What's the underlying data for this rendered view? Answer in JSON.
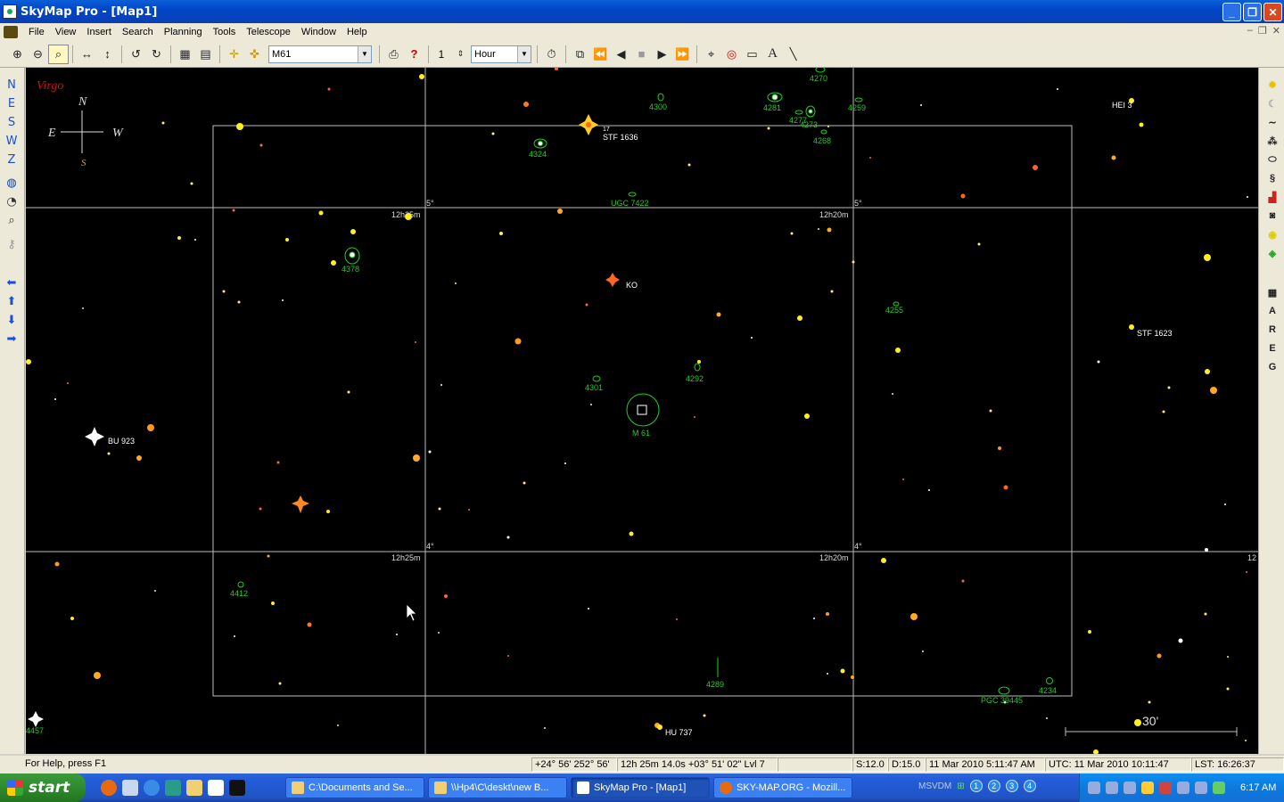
{
  "window": {
    "title": "SkyMap Pro - [Map1]"
  },
  "menu": [
    "File",
    "View",
    "Insert",
    "Search",
    "Planning",
    "Tools",
    "Telescope",
    "Window",
    "Help"
  ],
  "toolbar": {
    "object_field": "M61",
    "step_value": "1",
    "step_unit": "Hour",
    "icons": [
      "zoom-in-icon",
      "zoom-out-icon",
      "zoom-select-icon",
      "pan-horizontal-icon",
      "pan-vertical-icon",
      "rotate-left-icon",
      "rotate-right-icon",
      "grid-icon",
      "grid-alt-icon",
      "center-icon",
      "center-alt-icon",
      "print-icon",
      "help-pointer-icon",
      "stopwatch-icon",
      "link-icon",
      "rewind-icon",
      "step-back-icon",
      "stop-icon",
      "play-icon",
      "fast-forward-icon",
      "telescope-icon",
      "target-icon",
      "rectangle-icon",
      "text-icon",
      "line-icon"
    ]
  },
  "leftbar": {
    "directions": [
      "N",
      "E",
      "S",
      "W",
      "Z"
    ],
    "icons": [
      "globe-icon",
      "compass-icon",
      "magnifier-icon",
      "key-icon",
      "arrow-left-icon",
      "arrow-up-icon",
      "arrow-down-icon",
      "arrow-right-icon"
    ]
  },
  "rightbar": {
    "icons": [
      "sun-icon",
      "moon-icon",
      "comet-icon",
      "asteroid-icon",
      "galaxy-icon",
      "nebula-icon",
      "cluster-icon",
      "camera-icon",
      "bulb-icon",
      "colors-icon",
      "grid-table-icon"
    ],
    "letters": [
      "A",
      "R",
      "E",
      "G"
    ]
  },
  "map": {
    "constellation": "Virgo",
    "compass": {
      "n": "N",
      "e": "E",
      "w": "W",
      "s": "S"
    },
    "ra_labels": [
      "12h25m",
      "12h20m",
      "12h25m",
      "12h20m",
      "12"
    ],
    "dec_labels": [
      "5°",
      "5°",
      "4°",
      "4°"
    ],
    "objects": [
      {
        "label": "4270",
        "color": "#22cc22"
      },
      {
        "label": "4300",
        "color": "#22cc22"
      },
      {
        "label": "4281",
        "color": "#22cc22"
      },
      {
        "label": "4259",
        "color": "#22cc22"
      },
      {
        "label": "4277",
        "color": "#22cc22"
      },
      {
        "label": "4273",
        "color": "#22cc22"
      },
      {
        "label": "4268",
        "color": "#22cc22"
      },
      {
        "label": "4324",
        "color": "#22cc22"
      },
      {
        "label": "UGC 7422",
        "color": "#22cc22"
      },
      {
        "label": "4378",
        "color": "#22cc22"
      },
      {
        "label": "4255",
        "color": "#22cc22"
      },
      {
        "label": "4301",
        "color": "#22cc22"
      },
      {
        "label": "4292",
        "color": "#22cc22"
      },
      {
        "label": "M 61",
        "color": "#22cc22"
      },
      {
        "label": "4412",
        "color": "#22cc22"
      },
      {
        "label": "4289",
        "color": "#22cc22"
      },
      {
        "label": "PGC 39445",
        "color": "#22cc22"
      },
      {
        "label": "4234",
        "color": "#22cc22"
      },
      {
        "label": "4457",
        "color": "#22cc22"
      }
    ],
    "star_labels": [
      "STF 1636",
      "17",
      "HEI 3",
      "KO",
      "STF 1623",
      "BU 923",
      "HU 737"
    ],
    "scale_label": "30'"
  },
  "status": {
    "help": "For Help, press F1",
    "altaz": "+24° 56'  252° 56'",
    "radec": "12h 25m 14.0s  +03° 51' 02\"  Lvl 7",
    "s": "S:12.0",
    "d": "D:15.0",
    "local_time": "11 Mar 2010 5:11:47 AM",
    "utc": "UTC: 11 Mar 2010 10:11:47",
    "lst": "LST: 16:26:37"
  },
  "taskbar": {
    "start": "start",
    "tasks": [
      "C:\\Documents and Se...",
      "\\\\Hp4\\C\\deskt\\new B...",
      "SkyMap Pro - [Map1]",
      "SKY-MAP.ORG - Mozill..."
    ],
    "lang": "MSVDM",
    "desktops": [
      "1",
      "2",
      "3",
      "4"
    ],
    "clock": "6:17 AM"
  }
}
